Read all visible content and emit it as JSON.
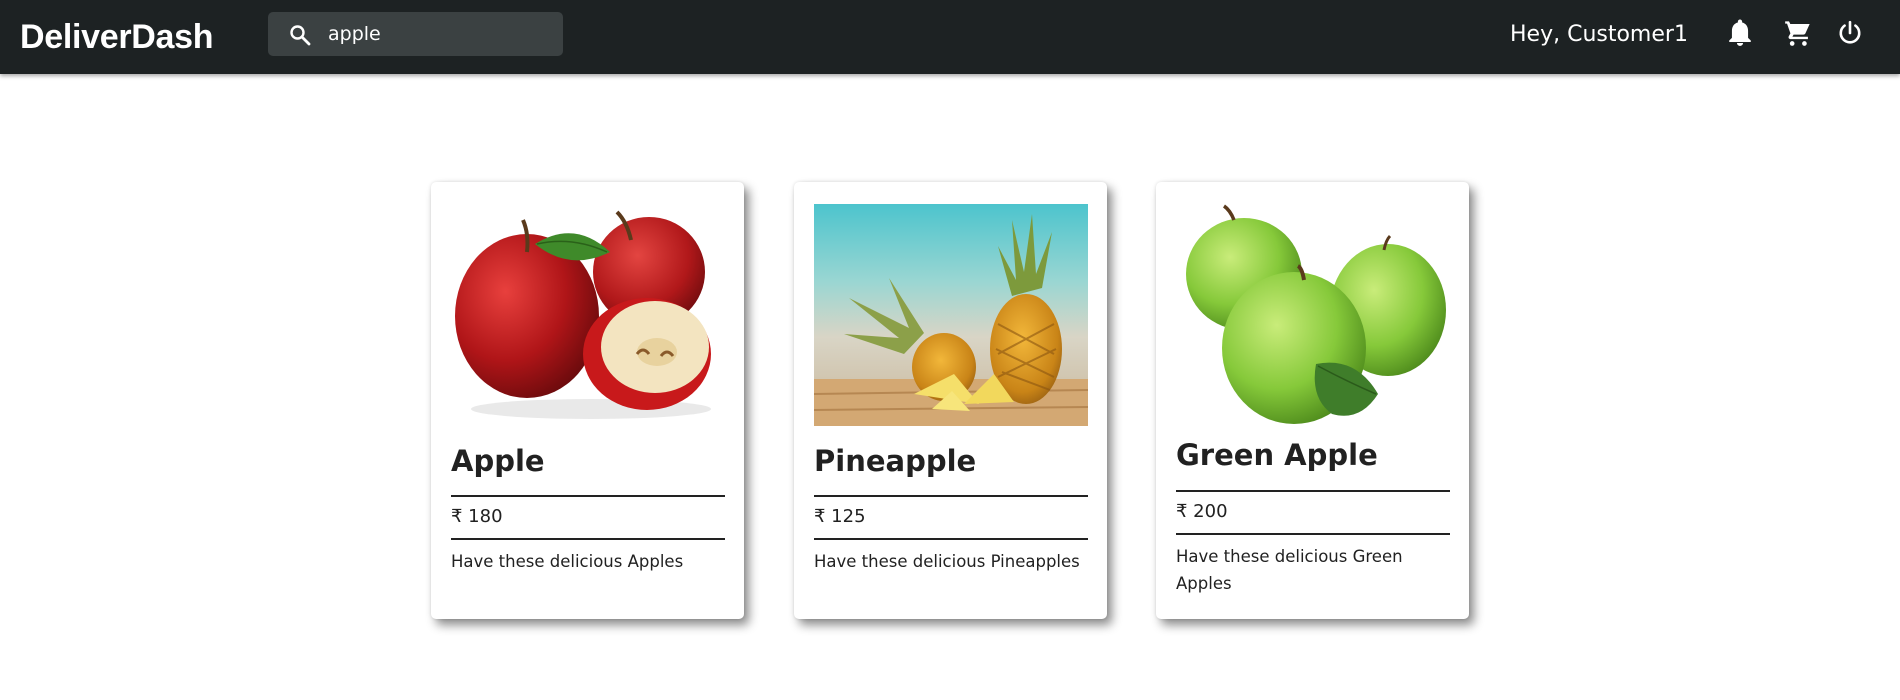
{
  "header": {
    "brand": "DeliverDash",
    "search": {
      "value": "apple",
      "placeholder": ""
    },
    "greeting": "Hey, Customer1",
    "icons": [
      "bell-icon",
      "cart-icon",
      "power-icon"
    ]
  },
  "products": [
    {
      "name": "Apple",
      "price": "₹ 180",
      "description": "Have these delicious Apples",
      "image": "red-apples-image"
    },
    {
      "name": "Pineapple",
      "price": "₹ 125",
      "description": "Have these delicious Pineapples",
      "image": "pineapple-image"
    },
    {
      "name": "Green Apple",
      "price": "₹ 200",
      "description": "Have these delicious Green Apples",
      "image": "green-apples-image"
    }
  ],
  "colors": {
    "appbar": "#1d2223",
    "search_bg": "#3b4142",
    "text": "#212121"
  }
}
